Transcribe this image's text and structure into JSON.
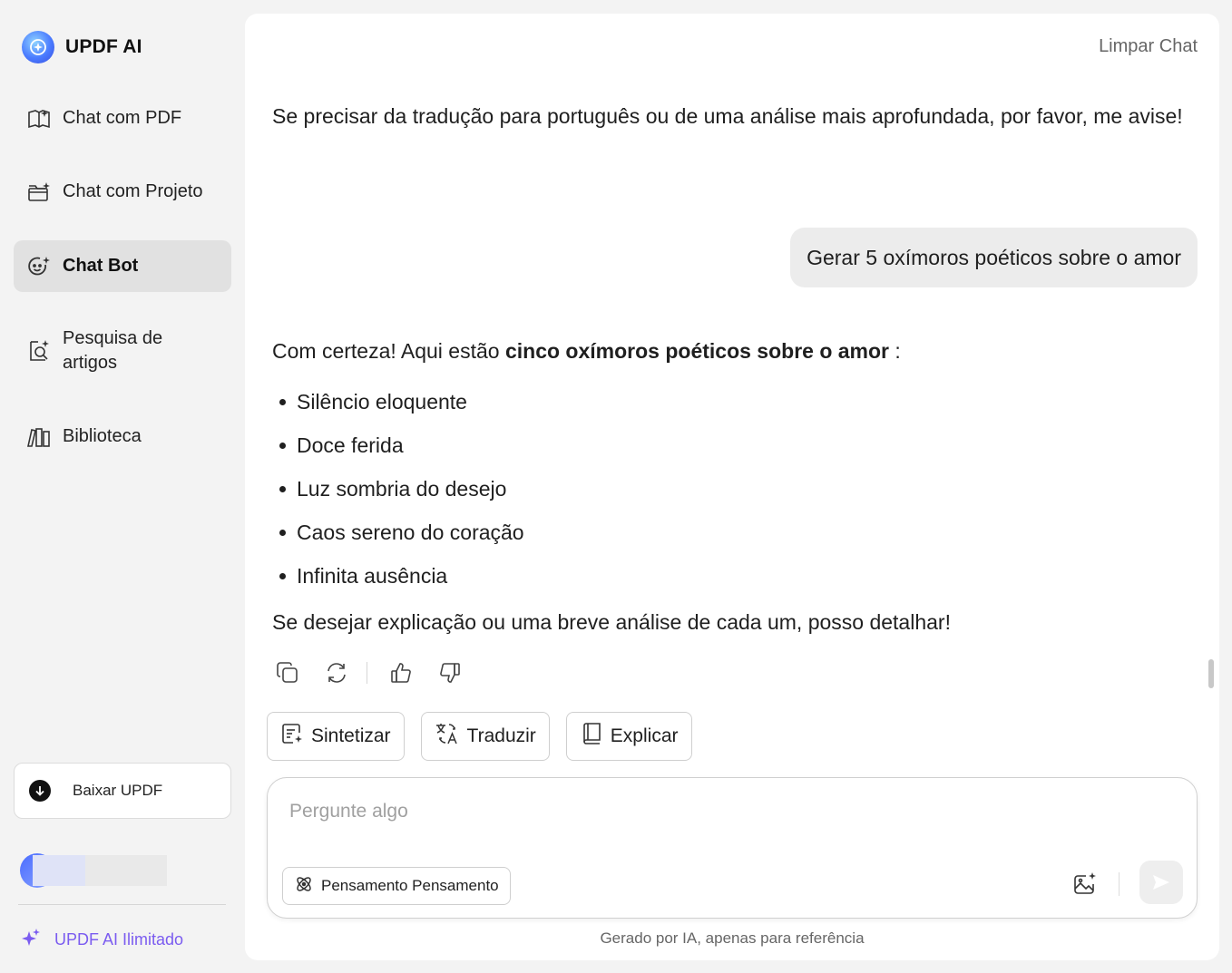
{
  "brand": {
    "name": "UPDF AI"
  },
  "sidebar": {
    "items": [
      {
        "label": "Chat com PDF",
        "icon": "book-open-icon"
      },
      {
        "label": "Chat com Projeto",
        "icon": "folder-sparkle-icon"
      },
      {
        "label": "Chat Bot",
        "icon": "bot-face-icon",
        "active": true
      },
      {
        "label": "Pesquisa de artigos",
        "icon": "document-search-icon"
      },
      {
        "label": "Biblioteca",
        "icon": "library-icon"
      }
    ],
    "download_label": "Baixar UPDF",
    "unlimited_label": "UPDF AI Ilimitado"
  },
  "header": {
    "clear_chat": "Limpar Chat"
  },
  "chat": {
    "prev_message": "Se precisar da tradução para português ou de uma análise mais aprofundada, por favor, me avise!",
    "user_message": "Gerar 5 oxímoros poéticos sobre o amor",
    "answer_intro_prefix": "Com certeza! Aqui estão ",
    "answer_intro_bold": "cinco oxímoros poéticos sobre o amor",
    "answer_intro_suffix": " :",
    "answer_items": [
      "Silêncio eloquente",
      "Doce ferida",
      "Luz sombria do desejo",
      "Caos sereno do coração",
      "Infinita ausência"
    ],
    "answer_outro": "Se desejar explicação ou uma breve análise de cada um, posso detalhar!"
  },
  "quick_actions": {
    "summarize": "Sintetizar",
    "translate": "Traduzir",
    "explain": "Explicar"
  },
  "input": {
    "placeholder": "Pergunte algo",
    "value": "",
    "thinking_label": "Pensamento Pensamento"
  },
  "footer": {
    "note": "Gerado por IA, apenas para referência"
  },
  "colors": {
    "accent": "#7b5cf0",
    "active_bg": "#e1e1e1",
    "bubble_bg": "#ececec"
  }
}
